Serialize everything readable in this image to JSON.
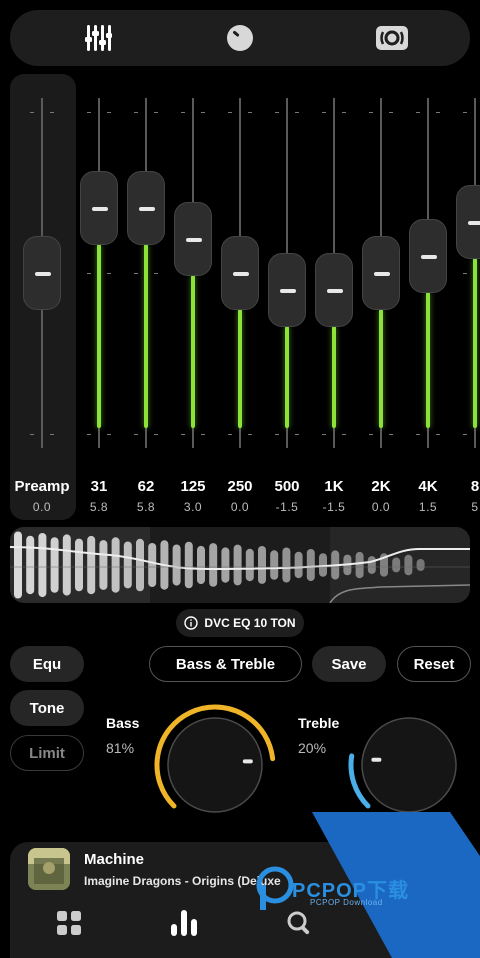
{
  "tabs": [
    {
      "name": "equalizer-tab-icon"
    },
    {
      "name": "knob-tab-icon"
    },
    {
      "name": "speaker-tab-icon"
    }
  ],
  "preamp": {
    "label": "Preamp",
    "value": "0.0",
    "level": 0.0
  },
  "bands": [
    {
      "freq": "31",
      "gain": "5.8",
      "level": 5.8
    },
    {
      "freq": "62",
      "gain": "5.8",
      "level": 5.8
    },
    {
      "freq": "125",
      "gain": "3.0",
      "level": 3.0
    },
    {
      "freq": "250",
      "gain": "0.0",
      "level": 0.0
    },
    {
      "freq": "500",
      "gain": "-1.5",
      "level": -1.5
    },
    {
      "freq": "1K",
      "gain": "-1.5",
      "level": -1.5
    },
    {
      "freq": "2K",
      "gain": "0.0",
      "level": 0.0
    },
    {
      "freq": "4K",
      "gain": "1.5",
      "level": 1.5
    },
    {
      "freq": "8",
      "gain": "5",
      "level": 4.5
    }
  ],
  "preset": {
    "label": "DVC EQ 10 TON"
  },
  "modes": {
    "equ": "Equ",
    "tone": "Tone",
    "limit": "Limit"
  },
  "actions": {
    "bass_treble": "Bass & Treble",
    "save": "Save",
    "reset": "Reset"
  },
  "bass": {
    "label": "Bass",
    "value": "81%",
    "level": 0.81,
    "color": "#f0b429"
  },
  "treble": {
    "label": "Treble",
    "value": "20%",
    "level": 0.2,
    "color": "#4aaee8"
  },
  "player": {
    "title": "Machine",
    "artist": "Imagine Dragons - Origins (Deluxe"
  },
  "bottom_nav": [
    "grid-icon",
    "equalizer-bars-icon",
    "search-icon",
    "person-icon"
  ],
  "watermark": {
    "text": "PCPOP下载",
    "sub": "PCPOP Download"
  },
  "colors": {
    "eq_level": "#8be33a",
    "bass_arc": "#f0b429",
    "treble_arc": "#4aaee8"
  }
}
